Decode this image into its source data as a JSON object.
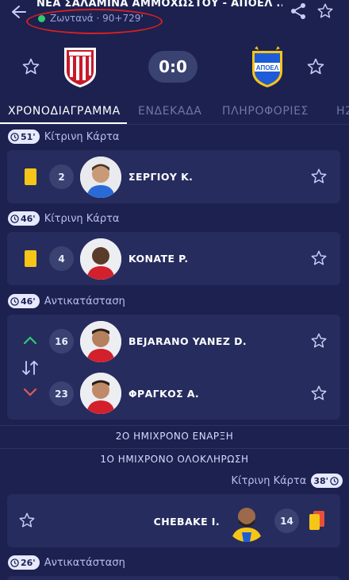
{
  "header": {
    "title": "ΝΕΑ ΣΑΛΑΜΙΝΑ ΑΜΜΟΧΩΣΤΟΥ - ΑΠΟΕΛ ...",
    "status": "Ζωντανά · 90+729'",
    "live_color": "#2ecc71",
    "annotation_color": "#d62020"
  },
  "score": {
    "value": "0:0"
  },
  "tabs": [
    {
      "label": "ΧΡΟΝΟΔΙΑΓΡΑΜΜΑ",
      "active": true
    },
    {
      "label": "ΕΝΔΕΚΑΔΑ"
    },
    {
      "label": "ΠΛΗΡΟΦΟΡΙΕΣ"
    },
    {
      "label": "Η2"
    }
  ],
  "events": [
    {
      "minute": "51'",
      "type": "Κίτρινη Κάρτα",
      "number": "2",
      "player": "ΣΕΡΓΙΟΥ Κ."
    },
    {
      "minute": "46'",
      "type": "Κίτρινη Κάρτα",
      "number": "4",
      "player": "KONATE P."
    },
    {
      "minute": "46'",
      "type": "Αντικατάσταση",
      "in": {
        "number": "16",
        "player": "BEJARANO YANEZ D."
      },
      "out": {
        "number": "23",
        "player": "ΦΡΑΓΚΟΣ Α."
      }
    },
    {
      "divider": "2Ο ΗΜΙΧΡΟΝΟ ΕΝΑΡΞΗ"
    },
    {
      "divider": "1Ο ΗΜΙΧΡΟΝΟ ΟΛΟΚΛΗΡΩΣΗ"
    },
    {
      "minute": "38'",
      "type": "Κίτρινη Κάρτα",
      "number": "14",
      "player": "CHEBAKE I."
    },
    {
      "minute": "26'",
      "type": "Αντικατάσταση"
    }
  ],
  "colors": {
    "background": "#1c2150",
    "card": "#262c5e",
    "yellow_card": "#f5c518",
    "red_card": "#e8503a",
    "arrow_in": "#2ecc71",
    "arrow_out": "#e05a5a"
  },
  "icons": [
    "back-arrow-icon",
    "share-icon",
    "star-icon",
    "clock-icon",
    "swap-icon"
  ]
}
